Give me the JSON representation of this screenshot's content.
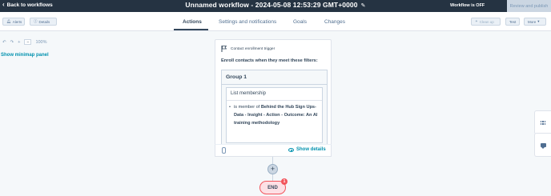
{
  "topbar": {
    "back_label": "Back to workflows",
    "title": "Unnamed workflow - 2024-05-08 12:53:29 GMT+0000",
    "status": "Workflow is OFF",
    "publish_label": "Review and publish"
  },
  "toolbar": {
    "alerts_label": "Alerts",
    "details_label": "Details",
    "cleanup_label": "Clean up",
    "test_label": "Test",
    "more_label": "More"
  },
  "tabs": [
    {
      "label": "Actions"
    },
    {
      "label": "Settings and notifications"
    },
    {
      "label": "Goals"
    },
    {
      "label": "Changes"
    }
  ],
  "canvas": {
    "zoom": "100%",
    "minimap_label": "Show minimap panel"
  },
  "trigger": {
    "header": "Contact enrollment trigger",
    "enroll_text": "Enroll contacts when they meet these filters:",
    "group_title": "Group 1",
    "filter_title": "List membership",
    "filter_prefix": "is member of ",
    "filter_value": "Behind the Hub Sign Ups-Data - Insight - Action - Outcome: An AI training methodology",
    "show_details": "Show details"
  },
  "flow": {
    "plus": "+",
    "end_label": "END",
    "end_badge": "1"
  },
  "colors": {
    "topbar": "#253342",
    "accent": "#0091ae",
    "end_border": "#f2545b"
  }
}
